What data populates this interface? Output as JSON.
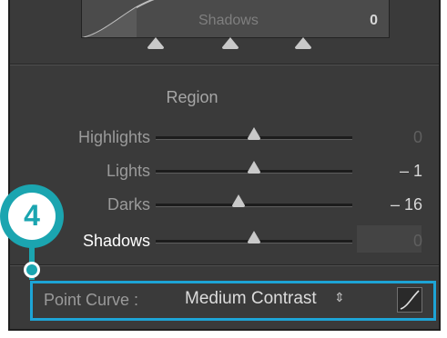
{
  "tone_curve": {
    "readout_label": "Shadows",
    "readout_value": "0"
  },
  "region": {
    "title": "Region",
    "sliders": [
      {
        "label": "Highlights",
        "value": "0",
        "position": 0.5,
        "active": false
      },
      {
        "label": "Lights",
        "value": "– 1",
        "position": 0.5,
        "active": true
      },
      {
        "label": "Darks",
        "value": "– 16",
        "position": 0.42,
        "active": true
      },
      {
        "label": "Shadows",
        "value": "0",
        "position": 0.5,
        "active": false
      }
    ]
  },
  "point_curve": {
    "label": "Point Curve :",
    "selected": "Medium Contrast",
    "arrows_icon": "up-down-arrows-icon",
    "edit_icon": "curve-edit-icon"
  },
  "callout": {
    "number": "4",
    "color": "#1ba5b0"
  },
  "colors": {
    "panel": "#3a3a3a",
    "highlight_border": "#1da4d6"
  }
}
